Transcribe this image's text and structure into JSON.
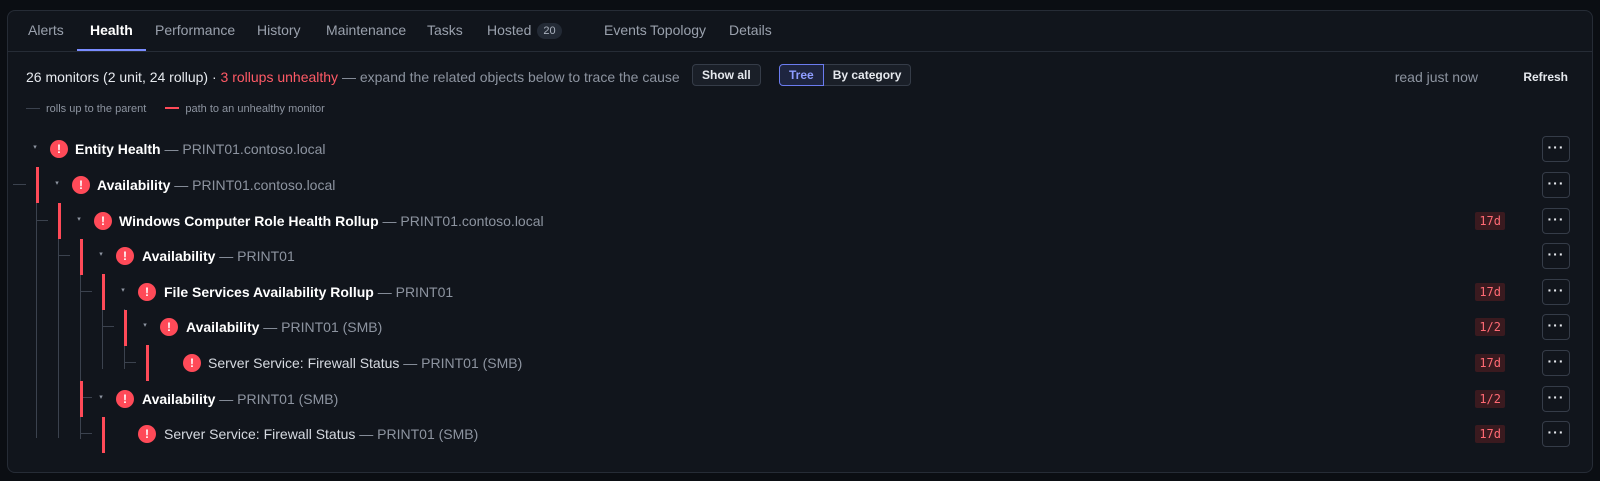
{
  "tabs": [
    {
      "label": "Alerts"
    },
    {
      "label": "Health"
    },
    {
      "label": "Performance"
    },
    {
      "label": "History"
    },
    {
      "label": "Maintenance"
    },
    {
      "label": "Tasks"
    },
    {
      "label": "Hosted",
      "count": "20"
    },
    {
      "label": "Events"
    },
    {
      "label": "Topology"
    },
    {
      "label": "Details"
    }
  ],
  "active_tab": "Health",
  "summary": {
    "main": "26 monitors (2 unit, 24 rollup) · ",
    "unhealthy": "3 rollups unhealthy",
    "hint": " — expand the related objects below to trace the cause"
  },
  "show_all_label": "Show all",
  "view_toggle": {
    "tree": "Tree",
    "category": "By category",
    "selected": "Tree"
  },
  "read_time": "read just now",
  "refresh_label": "Refresh",
  "legend": {
    "grey": "rolls up to the parent",
    "red": "path to an unhealthy monitor"
  },
  "status_color": "#ff4a58",
  "rows": [
    {
      "name": "Entity Health",
      "target": " — PRINT01.contoso.local",
      "badge": "",
      "state": "critical",
      "expanded": true,
      "bold": true
    },
    {
      "name": "Availability",
      "target": " — PRINT01.contoso.local",
      "badge": "",
      "state": "critical",
      "expanded": true,
      "bold": true
    },
    {
      "name": "Windows Computer Role Health Rollup",
      "target": " — PRINT01.contoso.local",
      "badge": "17d",
      "state": "critical",
      "expanded": true,
      "bold": true
    },
    {
      "name": "Availability",
      "target": " — PRINT01",
      "badge": "",
      "state": "critical",
      "expanded": true,
      "bold": true
    },
    {
      "name": "File Services Availability Rollup",
      "target": " — PRINT01",
      "badge": "17d",
      "state": "critical",
      "expanded": true,
      "bold": true
    },
    {
      "name": "Availability",
      "target": " — PRINT01 (SMB)",
      "badge": "1/2",
      "state": "critical",
      "expanded": true,
      "bold": true
    },
    {
      "name": "Server Service: Firewall Status",
      "target": " — PRINT01 (SMB)",
      "badge": "17d",
      "state": "critical",
      "expanded": false,
      "bold": false
    },
    {
      "name": "Availability",
      "target": " — PRINT01 (SMB)",
      "badge": "1/2",
      "state": "critical",
      "expanded": true,
      "bold": true
    },
    {
      "name": "Server Service: Firewall Status",
      "target": " — PRINT01 (SMB)",
      "badge": "17d",
      "state": "critical",
      "expanded": false,
      "bold": false
    }
  ],
  "icons": {
    "error": "exclamation-icon",
    "caret": "caret-down-icon",
    "more": "more-horizontal-icon"
  }
}
